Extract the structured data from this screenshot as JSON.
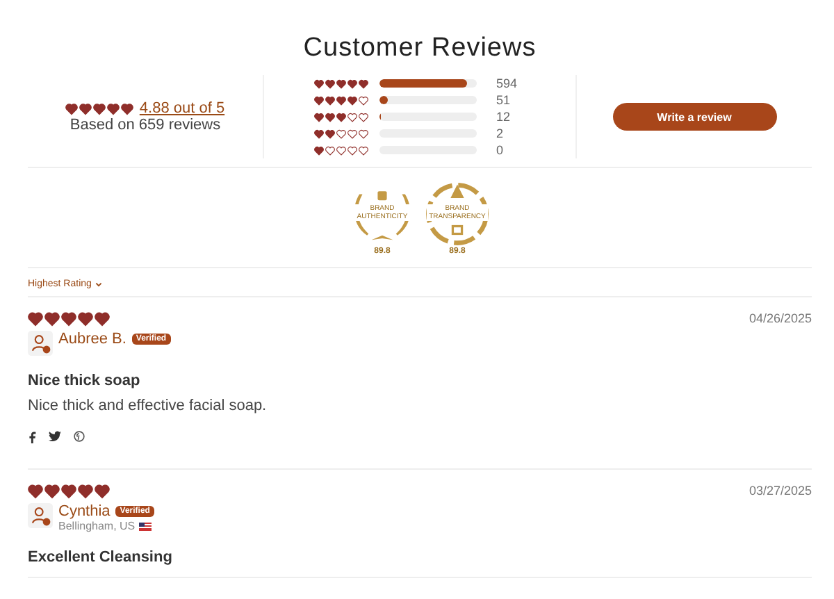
{
  "title": "Customer Reviews",
  "summary": {
    "stars": 5,
    "average": "4.88 out of 5",
    "based_on": "Based on 659 reviews"
  },
  "breakdown": [
    {
      "stars": 5,
      "level": 0.9,
      "count": "594"
    },
    {
      "stars": 4,
      "level": 0.08,
      "count": "51"
    },
    {
      "stars": 3,
      "level": 0.02,
      "count": "12"
    },
    {
      "stars": 2,
      "count": "2"
    },
    {
      "stars": 1,
      "count": "0"
    }
  ],
  "write_button": "Write a review",
  "badges": [
    {
      "kind": "laurel",
      "label": "BRAND AUTHENTICITY",
      "score": "89.8"
    },
    {
      "kind": "ring",
      "label": "BRAND TRANSPARENCY",
      "score": "89.8"
    }
  ],
  "sort": {
    "label": "Highest Rating"
  },
  "reviews": [
    {
      "stars": 5,
      "date": "04/26/2025",
      "name": "Aubree B.",
      "verified": "Verified",
      "title": "Nice thick soap",
      "body": "Nice thick and effective facial soap.",
      "share": true
    },
    {
      "stars": 5,
      "date": "03/27/2025",
      "name": "Cynthia",
      "verified": "Verified",
      "location": "Bellingham, US",
      "title": "Excellent Cleansing"
    }
  ]
}
